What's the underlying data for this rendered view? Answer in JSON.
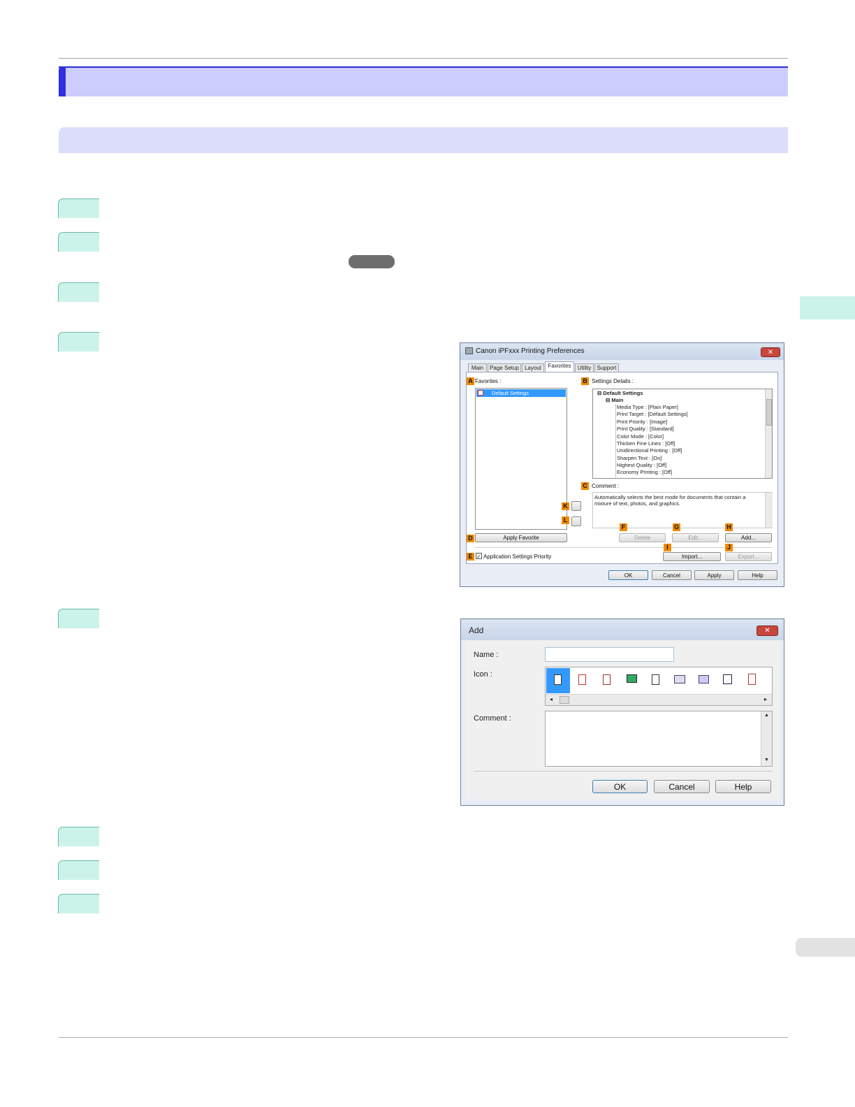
{
  "prefs_dialog": {
    "title": "Canon iPFxxx Printing Preferences",
    "close": "✕",
    "tabs": [
      "Main",
      "Page Setup",
      "Layout",
      "Favorites",
      "Utility",
      "Support"
    ],
    "favorites_label": "Favorites :",
    "favorites_items": [
      "Default Settings"
    ],
    "settings_details_label": "Settings Details :",
    "tree": {
      "root": "Default Settings",
      "group": "Main",
      "lines": [
        "Media Type : [Plain Paper]",
        "Print Target : [Default Settings]",
        "Print Priority : [Image]",
        "Print Quality : [Standard]",
        "Color Mode : [Color]",
        "Thicken Fine Lines : [Off]",
        "Unidirectional Printing : [Off]",
        "Sharpen Text : [On]",
        "Highest Quality : [Off]",
        "Economy Printing : [Off]"
      ]
    },
    "comment_label": "Comment :",
    "comment_text": "Automatically selects the best mode for documents that contain a mixture of text, photos, and graphics.",
    "apply_favorite": "Apply Favorite",
    "app_priority": "Application Settings Priority",
    "delete": "Delete",
    "edit": "Edit...",
    "add": "Add...",
    "import": "Import...",
    "export": "Export...",
    "ok": "OK",
    "cancel": "Cancel",
    "apply": "Apply",
    "help": "Help",
    "badges": {
      "a": "A",
      "b": "B",
      "c": "C",
      "d": "D",
      "e": "E",
      "f": "F",
      "g": "G",
      "h": "H",
      "i": "I",
      "j": "J",
      "k": "K",
      "l": "L"
    },
    "app_priority_checked": true
  },
  "add_dialog": {
    "title": "Add",
    "close": "✕",
    "name_label": "Name :",
    "name_value": "",
    "icon_label": "Icon :",
    "icons": [
      "document-icon",
      "red-document-icon",
      "graph-document-icon",
      "photo-icon",
      "page-icon",
      "book-icon",
      "folded-page-icon",
      "a4-icon",
      "calendar-icon"
    ],
    "comment_label": "Comment :",
    "comment_value": "",
    "ok": "OK",
    "cancel": "Cancel",
    "help": "Help"
  }
}
